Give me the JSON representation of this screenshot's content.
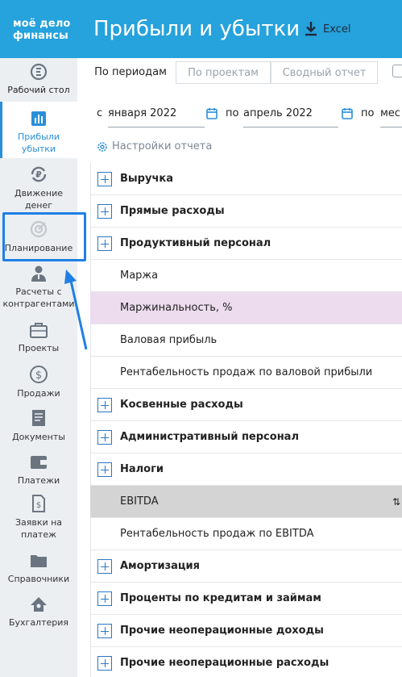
{
  "header": {
    "logo_line1": "моё дело",
    "logo_line2": "финансы",
    "title": "Прибыли и убытки",
    "excel_label": "Excel"
  },
  "sidebar": {
    "items": [
      {
        "label": "Рабочий стол",
        "icon": "desktop-icon"
      },
      {
        "label": "Прибыли убытки",
        "icon": "bar-chart-icon",
        "active": true
      },
      {
        "label": "Движение денег",
        "icon": "money-flow-icon"
      },
      {
        "label": "Планирование",
        "icon": "target-icon"
      },
      {
        "label": "Расчеты с контрагентами",
        "icon": "contractor-icon"
      },
      {
        "label": "Проекты",
        "icon": "briefcase-icon"
      },
      {
        "label": "Продажи",
        "icon": "dollar-icon"
      },
      {
        "label": "Документы",
        "icon": "document-icon"
      },
      {
        "label": "Платежи",
        "icon": "wallet-icon"
      },
      {
        "label": "Заявки на платеж",
        "icon": "invoice-icon"
      },
      {
        "label": "Справочники",
        "icon": "folder-icon"
      },
      {
        "label": "Бухгалтерия",
        "icon": "accounting-icon"
      }
    ]
  },
  "tabs": [
    {
      "label": "По периодам",
      "active": true
    },
    {
      "label": "По проектам",
      "active": false
    },
    {
      "label": "Сводный отчет",
      "active": false
    }
  ],
  "filters": {
    "from_prefix": "с",
    "from_value": "января 2022",
    "to_prefix": "по",
    "to_value": "апрель 2022",
    "group_prefix": "по",
    "group_value": "мес"
  },
  "settings_label": "Настройки отчета",
  "rows": [
    {
      "label": "Выручка",
      "type": "group"
    },
    {
      "label": "Прямые расходы",
      "type": "group"
    },
    {
      "label": "Продуктивный персонал",
      "type": "group"
    },
    {
      "label": "Маржа",
      "type": "leaf"
    },
    {
      "label": "Маржинальность, %",
      "type": "leaf",
      "style": "pink"
    },
    {
      "label": "Валовая прибыль",
      "type": "leaf"
    },
    {
      "label": "Рентабельность продаж по валовой прибыли",
      "type": "leaf"
    },
    {
      "label": "Косвенные расходы",
      "type": "group"
    },
    {
      "label": "Административный персонал",
      "type": "group"
    },
    {
      "label": "Налоги",
      "type": "group"
    },
    {
      "label": "EBITDA",
      "type": "leaf",
      "style": "grey"
    },
    {
      "label": "Рентабельность продаж по EBITDA",
      "type": "leaf"
    },
    {
      "label": "Амортизация",
      "type": "group"
    },
    {
      "label": "Проценты по кредитам и займам",
      "type": "group"
    },
    {
      "label": "Прочие неоперационные доходы",
      "type": "group"
    },
    {
      "label": "Прочие неоперационные расходы",
      "type": "group"
    }
  ],
  "colors": {
    "header_bg": "#26a2dc",
    "accent": "#2a8fd8",
    "highlight_box": "#1f7fe6",
    "pink_row": "#ecdcee",
    "grey_row": "#d4d4d4"
  }
}
